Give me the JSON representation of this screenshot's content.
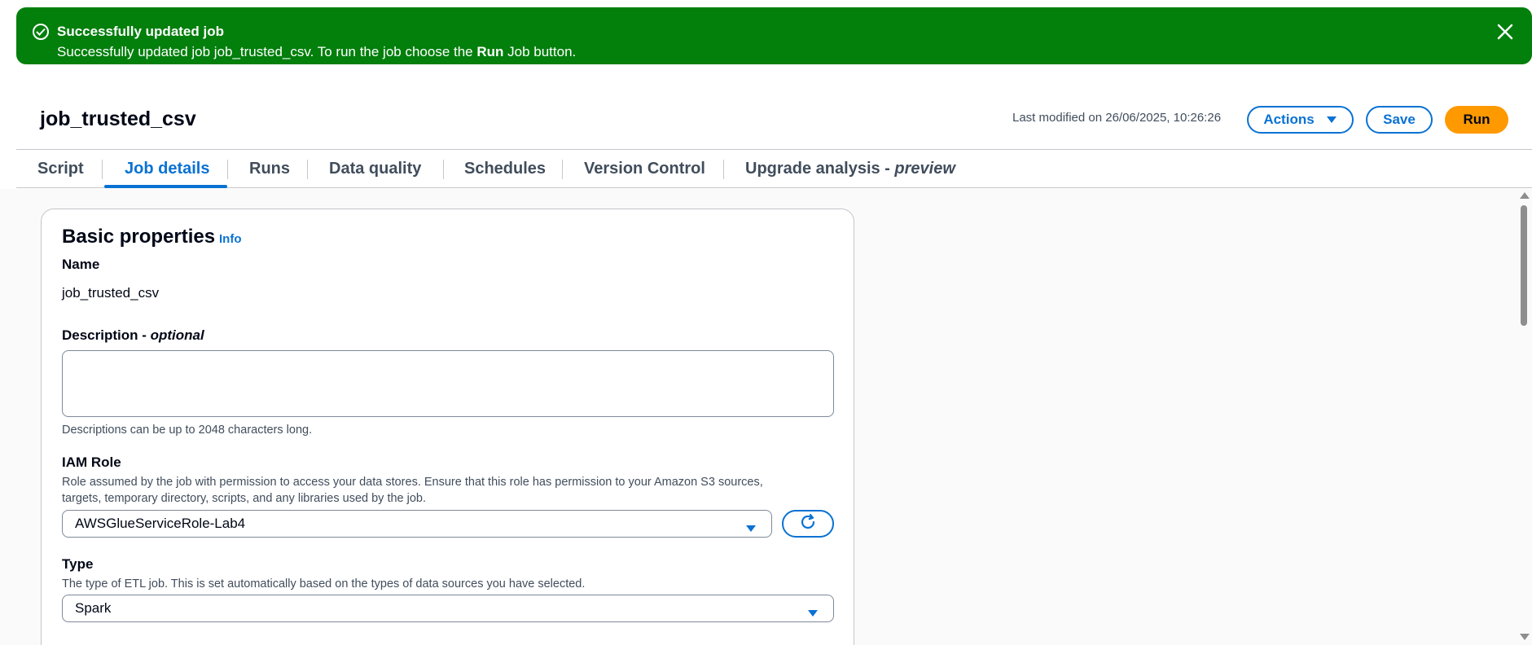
{
  "flash": {
    "title": "Successfully updated job",
    "message_prefix": "Successfully updated job job_trusted_csv. To run the job choose the ",
    "message_bold": "Run",
    "message_suffix": " Job button.",
    "icon": "success-check-icon",
    "close_icon": "close-icon",
    "color": "#037f0c"
  },
  "header": {
    "job_name": "job_trusted_csv",
    "last_modified": "Last modified on 26/06/2025, 10:26:26",
    "actions_label": "Actions",
    "save_label": "Save",
    "run_label": "Run"
  },
  "tabs": [
    {
      "label": "Script",
      "active": false
    },
    {
      "label": "Job details",
      "active": true
    },
    {
      "label": "Runs",
      "active": false
    },
    {
      "label": "Data quality",
      "active": false
    },
    {
      "label": "Schedules",
      "active": false
    },
    {
      "label": "Version Control",
      "active": false
    },
    {
      "label": "Upgrade analysis - ",
      "label_italic": "preview",
      "active": false
    }
  ],
  "basic_properties": {
    "title": "Basic properties",
    "info_link": "Info",
    "name_label": "Name",
    "name_value": "job_trusted_csv",
    "description_label": "Description - ",
    "description_label_italic": "optional",
    "description_value": "",
    "description_hint": "Descriptions can be up to 2048 characters long.",
    "iam_label": "IAM Role",
    "iam_hint_line1": "Role assumed by the job with permission to access your data stores. Ensure that this role has permission to your Amazon S3 sources,",
    "iam_hint_line2": "targets, temporary directory, scripts, and any libraries used by the job.",
    "iam_value": "AWSGlueServiceRole-Lab4",
    "type_label": "Type",
    "type_hint": "The type of ETL job. This is set automatically based on the types of data sources you have selected.",
    "type_value": "Spark"
  },
  "colors": {
    "accent": "#0972d3",
    "run_button": "#ff9900",
    "success": "#037f0c"
  }
}
